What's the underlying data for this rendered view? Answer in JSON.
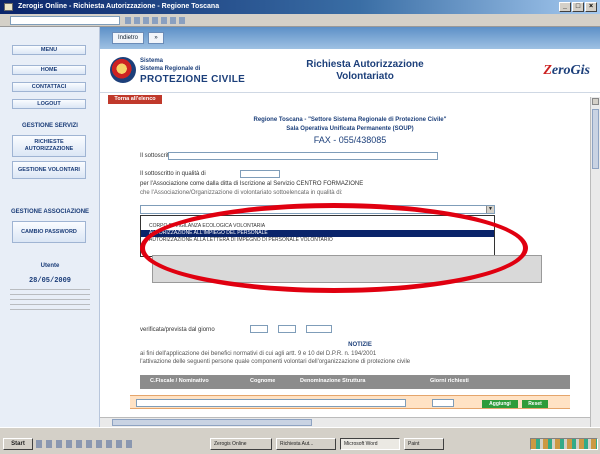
{
  "window": {
    "title": "Zerogis Online - Richiesta Autorizzazione - Regione Toscana"
  },
  "sidebar": {
    "buttons": [
      {
        "label": "MENU"
      },
      {
        "label": "HOME"
      },
      {
        "label": "CONTATTACI"
      },
      {
        "label": "LOGOUT"
      }
    ],
    "section1": "GESTIONE SERVIZI",
    "section1_items": [
      {
        "label": "RICHIESTE AUTORIZZAZIONE"
      },
      {
        "label": "GESTIONE VOLONTARI"
      }
    ],
    "section2": "GESTIONE ASSOCIAZIONE",
    "section2_items": [
      {
        "label": "CAMBIO PASSWORD"
      }
    ],
    "user_label": "Utente",
    "user_name": "Utente",
    "date": "28/05/2009"
  },
  "nav": {
    "back": "Indietro",
    "forward": "»"
  },
  "header": {
    "org_line1": "Sistema",
    "org_line2": "Sistema Regionale di",
    "org_line3": "PROTEZIONE CIVILE",
    "title": "Richiesta Autorizzazione Volontariato",
    "brand": "ZeroGis"
  },
  "red_tab": "Torna all'elenco",
  "form": {
    "heading1": "Regione Toscana - \"Settore Sistema Regionale di Protezione Civile\"",
    "heading2": "Sala Operativa Unificata Permanente (SOUP)",
    "fax": "FAX - 055/438085",
    "field1_label": "Il sottoscritto",
    "field2_label": "Il sottoscritto in qualità di",
    "line1": "per l'Associazione come dalla ditta di Iscrizione al Servizio CENTRO FORMAZIONE",
    "line2": "che l'Associazione/Organizzazione di volontariato sottoelencata in qualità di:",
    "dropdown_items": [
      "",
      "CORPO DI VIGILANZA ECOLOGICA VOLONTARIA",
      "AUTORIZZAZIONE ALL'IMPIEGO DEL PERSONALE",
      "AUTORIZZAZIONE ALLA LETTERA DI IMPEGNO DI PERSONALE VOLONTARIO"
    ],
    "selected_index": 2,
    "period_label": "verificata/prevista dal giorno",
    "notice_title": "NOTIZIE",
    "notice_line1": "ai fini dell'applicazione dei benefici normativi di cui agli artt. 9 e 10 del D.P.R. n. 194/2001",
    "notice_line2": "l'attivazione delle seguenti persone quale componenti volontari dell'organizzazione di protezione civile"
  },
  "table": {
    "headers": [
      "C.Fiscale / Nominativo",
      "Cognome",
      "Denominazione Struttura",
      "Giorni richiesti"
    ],
    "buttons": {
      "add": "Aggiungi",
      "reset": "Reset"
    }
  },
  "taskbar": {
    "start": "Start",
    "items": [
      "Zerogis Online",
      "Richiesta Aut...",
      "Microsoft Word",
      "Paint"
    ],
    "active_index": 2
  }
}
